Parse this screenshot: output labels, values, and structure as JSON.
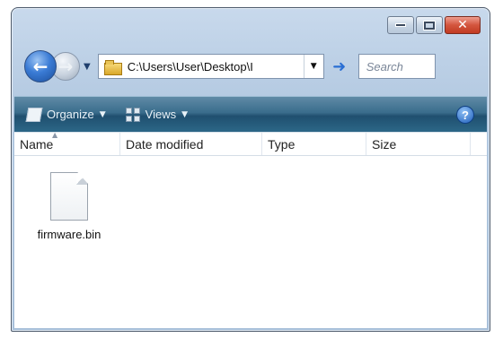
{
  "window": {
    "caption_buttons": [
      "minimize",
      "maximize",
      "close"
    ]
  },
  "navigation": {
    "address": "C:\\Users\\User\\Desktop\\I",
    "search_placeholder": "Search"
  },
  "toolbar": {
    "organize_label": "Organize",
    "views_label": "Views"
  },
  "file_list": {
    "columns": [
      "Name",
      "Date modified",
      "Type",
      "Size"
    ],
    "items": [
      {
        "name": "firmware.bin",
        "icon": "file-icon"
      }
    ]
  },
  "colors": {
    "command_bar": "#2c6787",
    "close_button": "#c23a22",
    "window_frame": "#b3c9e1"
  }
}
